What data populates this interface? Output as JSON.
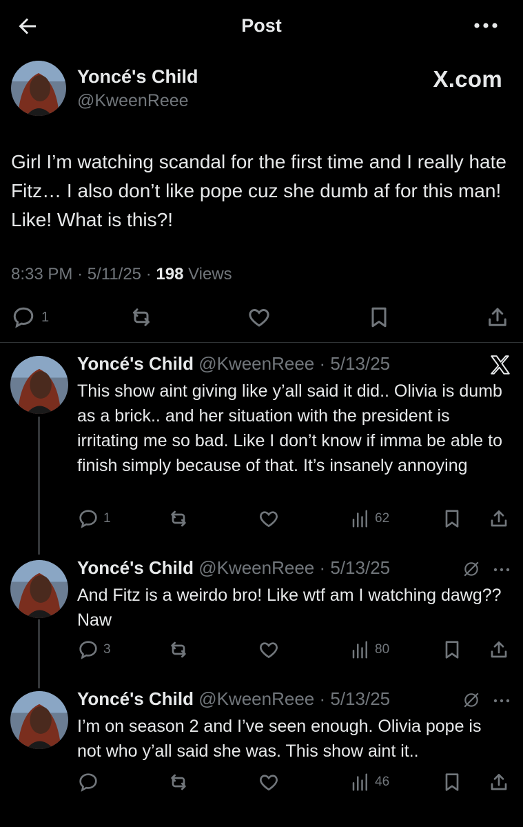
{
  "header": {
    "title": "Post",
    "back_icon": "arrow-left-icon",
    "more_icon": "more-horizontal-icon"
  },
  "main_post": {
    "author_name": "Yoncé's Child",
    "handle": "@KweenReee",
    "source_badge": "X.com",
    "text": "Girl I’m watching scandal for the first time and I really hate Fitz… I also don’t like pope cuz she dumb af for this man! Like! What is this?!",
    "time": "8:33 PM",
    "date": "5/11/25",
    "views_count": "198",
    "views_label": "Views",
    "sep": "·",
    "reply_count": "1"
  },
  "replies": [
    {
      "author_name": "Yoncé's Child",
      "handle": "@KweenReee",
      "date": "· 5/13/25",
      "text": "This show aint giving like y’all said it did.. Olivia is dumb as a brick.. and her situation with the president is irritating me so bad. Like I don’t know if imma be able to finish simply because of that. It’s insanely annoying",
      "reply_count": "1",
      "views": "62"
    },
    {
      "author_name": "Yoncé's Child",
      "handle": "@KweenReee",
      "date": "· 5/13/25",
      "text": "And Fitz is a weirdo bro! Like wtf am I watching dawg?? Naw",
      "reply_count": "3",
      "views": "80"
    },
    {
      "author_name": "Yoncé's Child",
      "handle": "@KweenReee",
      "date": "· 5/13/25",
      "text": "I’m on season 2 and I’ve seen enough. Olivia pope is not who y’all said she was. This show aint it..",
      "reply_count": "",
      "views": "46"
    }
  ],
  "colors": {
    "background": "#000000",
    "text": "#e7e9ea",
    "muted": "#71767b",
    "divider": "#2f3336"
  }
}
